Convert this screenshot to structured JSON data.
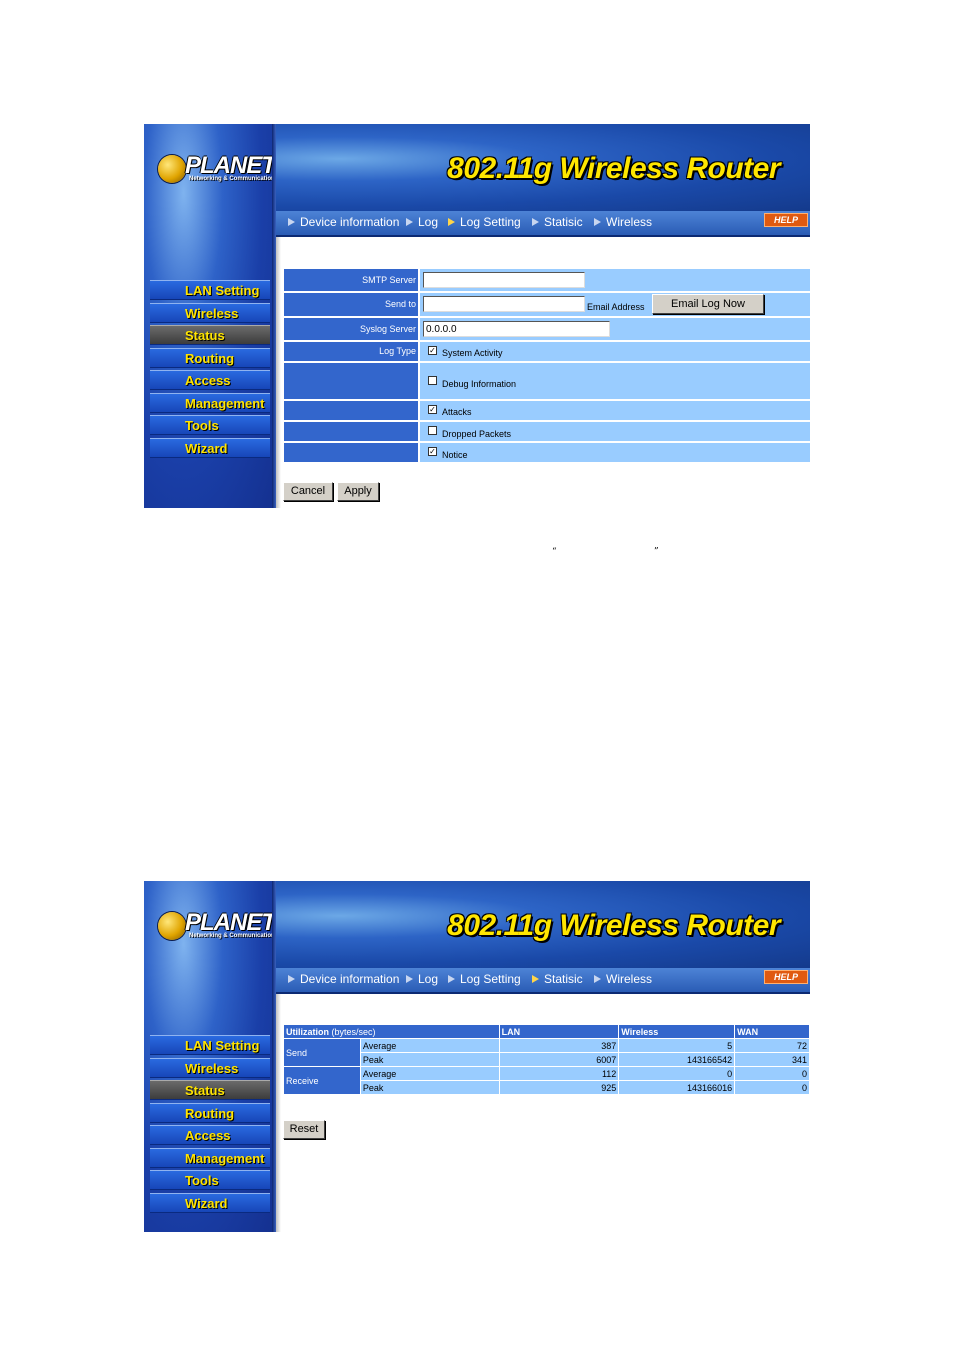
{
  "brand": {
    "logo": "PLANET",
    "tagline": "Networking & Communication",
    "title": "802.11g Wireless Router",
    "help": "HELP"
  },
  "menu": [
    "LAN Setting",
    "Wireless",
    "Status",
    "Routing",
    "Access",
    "Management",
    "Tools",
    "Wizard"
  ],
  "nav": [
    "Device information",
    "Log",
    "Log Setting",
    "Statisic",
    "Wireless"
  ],
  "log_setting": {
    "smtp_label": "SMTP Server",
    "smtp_value": "",
    "sendto_label": "Send to",
    "sendto_value": "",
    "email_address_label": "Email Address",
    "email_log_now": "Email Log Now",
    "syslog_label": "Syslog Server",
    "syslog_value": "0.0.0.0",
    "log_type_label": "Log Type",
    "log_types": [
      {
        "label": "System Activity",
        "checked": true
      },
      {
        "label": "Debug Information",
        "checked": false
      },
      {
        "label": "Attacks",
        "checked": true
      },
      {
        "label": "Dropped Packets",
        "checked": false
      },
      {
        "label": "Notice",
        "checked": true
      }
    ],
    "cancel": "Cancel",
    "apply": "Apply"
  },
  "quote_marks": {
    "open": "“",
    "close": "”"
  },
  "statistic": {
    "header": {
      "utilization": "Utilization",
      "units": "(bytes/sec)",
      "lan": "LAN",
      "wireless": "Wireless",
      "wan": "WAN"
    },
    "send": "Send",
    "receive": "Receive",
    "average": "Average",
    "peak": "Peak",
    "rows": {
      "send_average": {
        "lan": "387",
        "wireless": "5",
        "wan": "72"
      },
      "send_peak": {
        "lan": "6007",
        "wireless": "143166542",
        "wan": "341"
      },
      "receive_average": {
        "lan": "112",
        "wireless": "0",
        "wan": "0"
      },
      "receive_peak": {
        "lan": "925",
        "wireless": "143166016",
        "wan": "0"
      }
    },
    "reset": "Reset"
  }
}
